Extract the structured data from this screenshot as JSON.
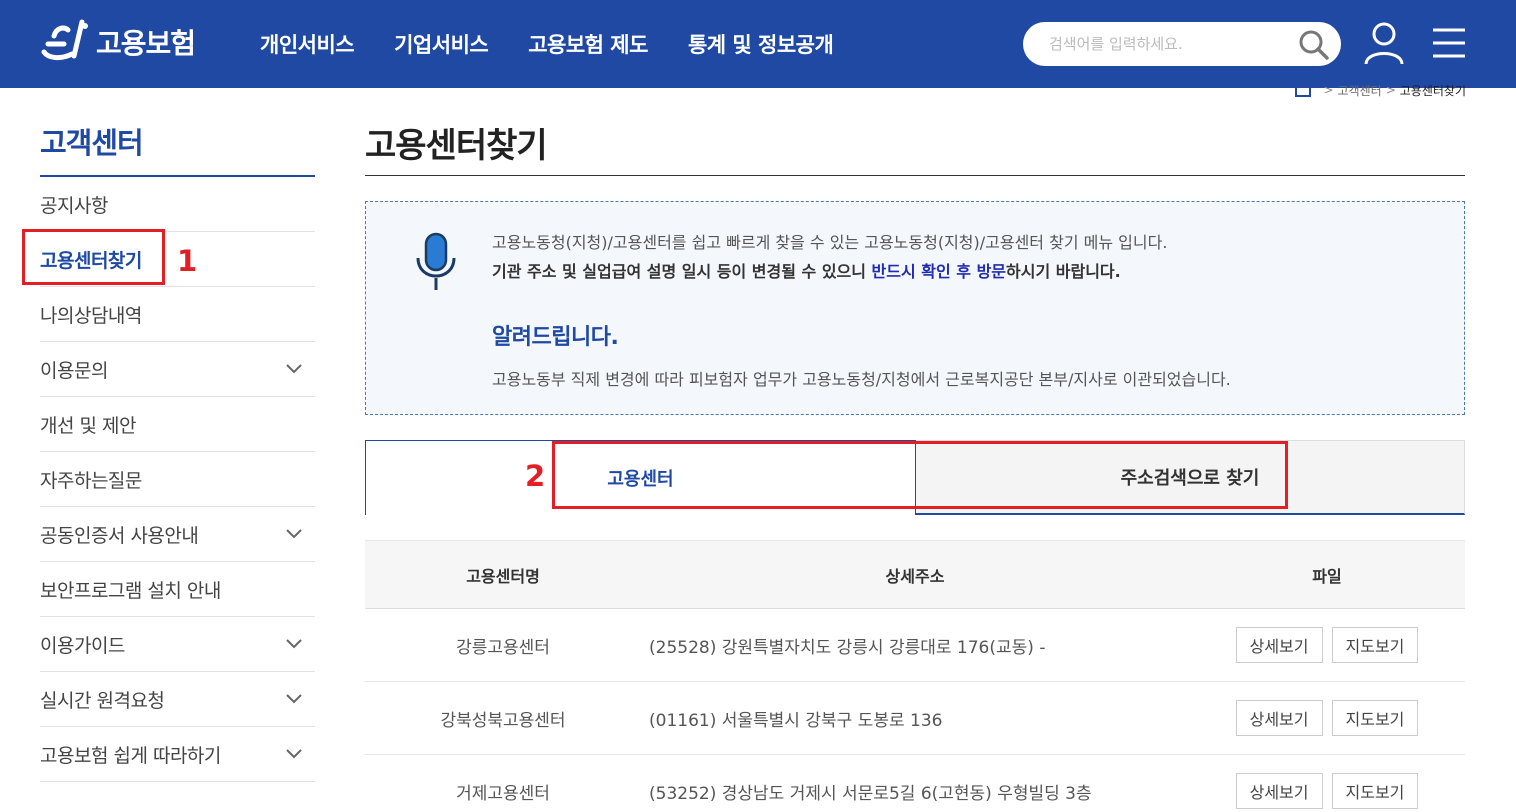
{
  "header": {
    "logo_text": "고용보험",
    "nav": [
      "개인서비스",
      "기업서비스",
      "고용보험 제도",
      "통계 및 정보공개"
    ],
    "search_placeholder": "검색어를 입력하세요."
  },
  "breadcrumb": {
    "items": [
      "고객센터",
      "고용센터찾기"
    ]
  },
  "sidebar": {
    "title": "고객센터",
    "items": [
      {
        "label": "공지사항",
        "has_sub": false
      },
      {
        "label": "고용센터찾기",
        "has_sub": false,
        "active": true
      },
      {
        "label": "나의상담내역",
        "has_sub": false
      },
      {
        "label": "이용문의",
        "has_sub": true
      },
      {
        "label": "개선 및 제안",
        "has_sub": false
      },
      {
        "label": "자주하는질문",
        "has_sub": false
      },
      {
        "label": "공동인증서 사용안내",
        "has_sub": true
      },
      {
        "label": "보안프로그램 설치 안내",
        "has_sub": false
      },
      {
        "label": "이용가이드",
        "has_sub": true
      },
      {
        "label": "실시간 원격요청",
        "has_sub": true
      },
      {
        "label": "고용보험 쉽게 따라하기",
        "has_sub": true
      }
    ]
  },
  "annotations": {
    "label1": "1",
    "label2": "2"
  },
  "main": {
    "title": "고용센터찾기",
    "notice": {
      "line1": "고용노동청(지청)/고용센터를 쉽고 빠르게 찾을 수 있는 고용노동청(지청)/고용센터 찾기 메뉴 입니다.",
      "line2_prefix": "기관 주소 및 실업급여 설명 일시 등이 변경될 수 있으니 ",
      "line2_emphasis": "반드시 확인 후 방문",
      "line2_suffix": "하시기 바랍니다.",
      "sub_title": "알려드립니다.",
      "line3": "고용노동부 직제 변경에 따라 피보험자 업무가 고용노동청/지청에서 근로복지공단 본부/지사로 이관되었습니다."
    },
    "tabs": [
      "고용센터",
      "주소검색으로 찾기"
    ],
    "table": {
      "headers": [
        "고용센터명",
        "상세주소",
        "파일"
      ],
      "rows": [
        {
          "name": "강릉고용센터",
          "address": "(25528) 강원특별자치도 강릉시 강릉대로 176(교동) -"
        },
        {
          "name": "강북성북고용센터",
          "address": "(01161) 서울특별시 강북구 도봉로 136"
        },
        {
          "name": "거제고용센터",
          "address": "(53252) 경상남도 거제시 서문로5길 6(고현동) 우형빌딩 3층"
        }
      ],
      "detail_btn": "상세보기",
      "map_btn": "지도보기"
    }
  },
  "colors": {
    "brand": "#1f49a3",
    "highlight": "#e31e24"
  }
}
